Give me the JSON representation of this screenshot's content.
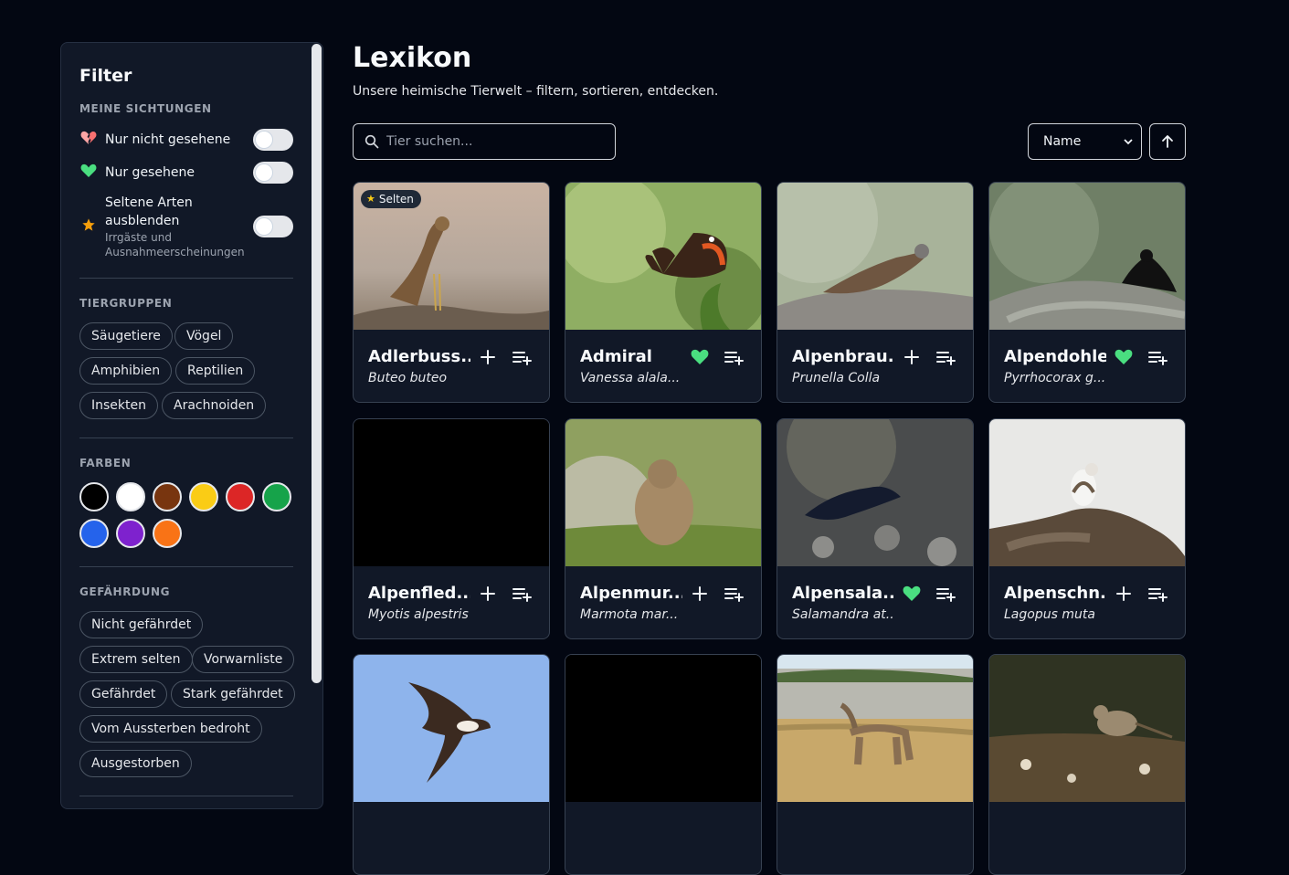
{
  "sidebar": {
    "title": "Filter",
    "sightings": {
      "label": "MEINE SICHTUNGEN",
      "items": [
        {
          "label": "Nur nicht gesehene",
          "icon": "broken-heart-icon",
          "on": false
        },
        {
          "label": "Nur gesehene",
          "icon": "green-heart-icon",
          "on": false
        },
        {
          "label_line1": "Seltene Arten",
          "label_line2": "ausblenden",
          "sub_line1": "Irrgäste und",
          "sub_line2": "Ausnahmeerscheinungen",
          "icon": "star-icon",
          "on": false
        }
      ]
    },
    "groups": {
      "label": "TIERGRUPPEN",
      "chips": [
        "Säugetiere",
        "Vögel",
        "Amphibien",
        "Reptilien",
        "Insekten",
        "Arachnoiden"
      ]
    },
    "colors": {
      "label": "FARBEN",
      "swatches": [
        "#000000",
        "#ffffff",
        "#78350f",
        "#facc15",
        "#dc2626",
        "#16a34a",
        "#2563eb",
        "#7e22ce",
        "#f97316"
      ]
    },
    "threat": {
      "label": "GEFÄHRDUNG",
      "chips": [
        "Nicht gefährdet",
        "Extrem selten",
        "Vorwarnliste",
        "Gefährdet",
        "Stark gefährdet",
        "Vom Aussterben bedroht",
        "Ausgestorben"
      ]
    }
  },
  "main": {
    "title": "Lexikon",
    "subtitle": "Unsere heimische Tierwelt – filtern, sortieren, entdecken.",
    "search_placeholder": "Tier suchen...",
    "sort_value": "Name"
  },
  "cards": [
    {
      "name": "Adlerbuss...",
      "sci": "Buteo buteo",
      "badge": "Selten",
      "seen": false
    },
    {
      "name": "Admiral",
      "sci": "Vanessa alala...",
      "badge": "",
      "seen": true
    },
    {
      "name": "Alpenbrau...",
      "sci": "Prunella Colla",
      "badge": "",
      "seen": false
    },
    {
      "name": "Alpendohle",
      "sci": "Pyrrhocorax g...",
      "badge": "",
      "seen": true
    },
    {
      "name": "Alpenfled...",
      "sci": "Myotis alpestris",
      "badge": "",
      "seen": false
    },
    {
      "name": "Alpenmur...",
      "sci": "Marmota mar...",
      "badge": "",
      "seen": false
    },
    {
      "name": "Alpensala...",
      "sci": "Salamandra at...",
      "badge": "",
      "seen": true
    },
    {
      "name": "Alpenschn...",
      "sci": "Lagopus muta",
      "badge": "",
      "seen": false
    },
    {
      "name": "",
      "sci": "",
      "badge": "",
      "seen": false
    },
    {
      "name": "",
      "sci": "",
      "badge": "",
      "seen": false
    },
    {
      "name": "",
      "sci": "",
      "badge": "",
      "seen": false
    },
    {
      "name": "",
      "sci": "",
      "badge": "",
      "seen": false
    }
  ]
}
